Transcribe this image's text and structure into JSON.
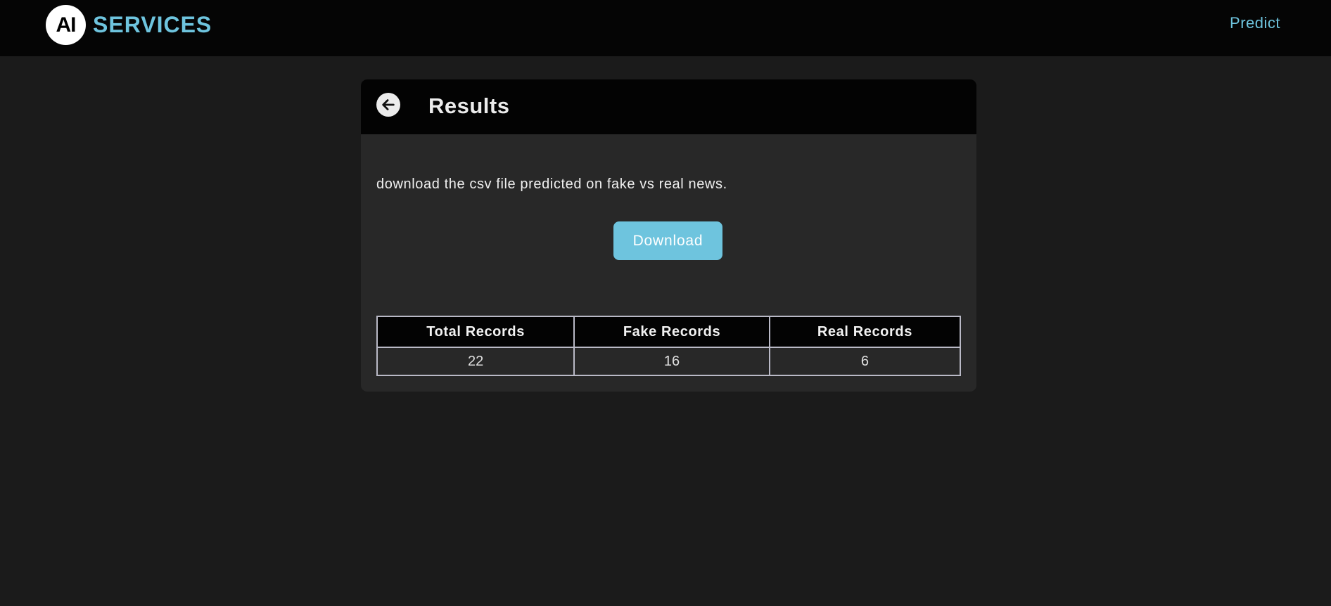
{
  "navbar": {
    "logo_initials": "AI",
    "brand_name": "SERVICES",
    "predict_link": "Predict"
  },
  "card": {
    "title": "Results",
    "description": "download the csv file predicted on fake vs real news.",
    "download_label": "Download"
  },
  "table": {
    "headers": [
      "Total Records",
      "Fake Records",
      "Real Records"
    ],
    "values": [
      "22",
      "16",
      "6"
    ]
  },
  "colors": {
    "accent": "#6ec4de",
    "background": "#1b1b1b",
    "card": "#282828",
    "header": "#030303"
  },
  "icons": {
    "back": "arrow-left-circle-icon"
  }
}
